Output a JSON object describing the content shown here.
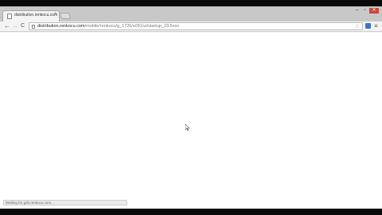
{
  "tab": {
    "title": "distribution.renkocu.com",
    "close": "×"
  },
  "window_controls": {
    "minimize": "–",
    "maximize": "▫",
    "close": "✕"
  },
  "nav": {
    "back": "←",
    "forward": "→",
    "reload": "C"
  },
  "address": {
    "host": "distribution.renkocu.com",
    "path": "/mobile/renkocu/g_1726/s091/ui/startup_23.5xxx"
  },
  "status": {
    "text": "Waiting for gdn.renkocu.com..."
  }
}
